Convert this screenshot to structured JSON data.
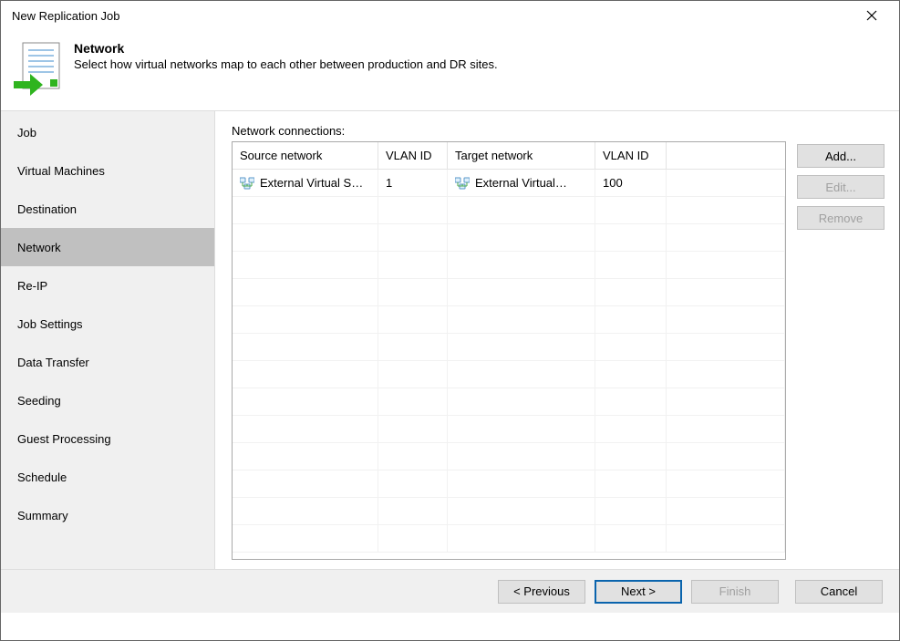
{
  "window": {
    "title": "New Replication Job"
  },
  "header": {
    "title": "Network",
    "description": "Select how virtual networks map to each other between production and DR sites."
  },
  "sidebar": {
    "items": [
      {
        "label": "Job"
      },
      {
        "label": "Virtual Machines"
      },
      {
        "label": "Destination"
      },
      {
        "label": "Network"
      },
      {
        "label": "Re-IP"
      },
      {
        "label": "Job Settings"
      },
      {
        "label": "Data Transfer"
      },
      {
        "label": "Seeding"
      },
      {
        "label": "Guest Processing"
      },
      {
        "label": "Schedule"
      },
      {
        "label": "Summary"
      }
    ],
    "active_index": 3
  },
  "content": {
    "table_label": "Network connections:",
    "columns": {
      "source_network": "Source network",
      "source_vlan": "VLAN ID",
      "target_network": "Target network",
      "target_vlan": "VLAN ID"
    },
    "rows": [
      {
        "source_network": "External Virtual S…",
        "source_vlan": "1",
        "target_network": "External Virtual…",
        "target_vlan": "100"
      }
    ],
    "buttons": {
      "add": "Add...",
      "edit": "Edit...",
      "remove": "Remove"
    }
  },
  "footer": {
    "previous": "< Previous",
    "next": "Next >",
    "finish": "Finish",
    "cancel": "Cancel"
  }
}
